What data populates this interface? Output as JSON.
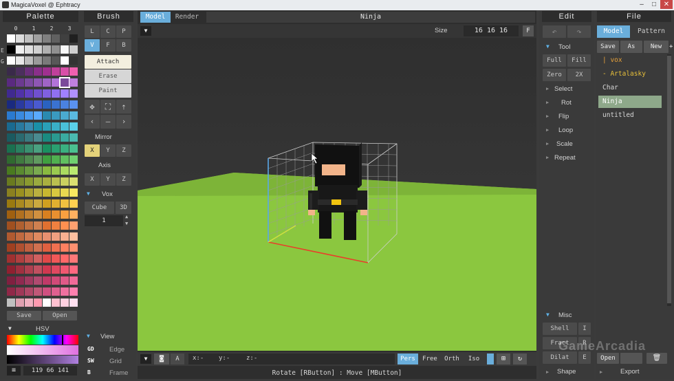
{
  "window": {
    "title": "MagicaVoxel @ Ephtracy",
    "controls": [
      "–",
      "□",
      "✕"
    ]
  },
  "palette": {
    "header": "Palette",
    "tabs": [
      "0",
      "1",
      "2",
      "3"
    ],
    "side_markers": [
      "E",
      "G"
    ],
    "save_label": "Save",
    "open_label": "Open",
    "hsv_label": "HSV",
    "color_values": "119 66 141",
    "selected_color": "#7b4a9a",
    "colors": [
      [
        "#ffffff",
        "#dcdcdc",
        "#c0c0c0",
        "#a0a0a0",
        "#808080",
        "#606060",
        "#404040",
        "#202020"
      ],
      [
        "#000000",
        "#f0f0f0",
        "#e0e0e0",
        "#d0d0d0",
        "#b0b0b0",
        "#909090",
        "#f8f8f8",
        "#cfcfcf"
      ],
      [
        "#ffffff",
        "#e8e8e8",
        "#bdbdbd",
        "#9a9a9a",
        "#7a7a7a",
        "#585858",
        "#ffffff",
        "#333333"
      ],
      [
        "#3a2a4a",
        "#4c2f5e",
        "#6a2f7a",
        "#8a2f8a",
        "#a0308f",
        "#c0409a",
        "#d84fa8",
        "#f060b0"
      ],
      [
        "#5a2a80",
        "#6b3a90",
        "#7b4aa0",
        "#8e56b4",
        "#a064c6",
        "#b273d8",
        "#7b4a9a",
        "#c080e0"
      ],
      [
        "#402a90",
        "#5032a8",
        "#6040c0",
        "#7050d0",
        "#8060e0",
        "#9070f0",
        "#a080ff",
        "#b090ff"
      ],
      [
        "#1a2a80",
        "#2a3aa0",
        "#3a4ac0",
        "#4a5ad0",
        "#2a62c0",
        "#3a72d0",
        "#4a82e0",
        "#5a92f0"
      ],
      [
        "#2a7ad0",
        "#3a8ae0",
        "#4a9af0",
        "#5aaaff",
        "#2a8ab0",
        "#3a9ac0",
        "#4aaad0",
        "#5abae0"
      ],
      [
        "#1a6a90",
        "#2a7aa0",
        "#3a8ab0",
        "#1a90a8",
        "#2aa0b8",
        "#3ab0c8",
        "#4ac0d8",
        "#5ad0e8"
      ],
      [
        "#1a5a60",
        "#2a6a70",
        "#3a7a80",
        "#4a8a90",
        "#1a8a80",
        "#2a9a90",
        "#3aaaa0",
        "#4abab0"
      ],
      [
        "#1a7050",
        "#2a8060",
        "#3a9070",
        "#4aa080",
        "#1a9060",
        "#2aa070",
        "#3ab080",
        "#4ac090"
      ],
      [
        "#306a30",
        "#407a40",
        "#508a50",
        "#609a60",
        "#40a040",
        "#50b050",
        "#60c060",
        "#70d070"
      ],
      [
        "#4a7a20",
        "#5a8a30",
        "#6a9a40",
        "#7aaa50",
        "#8aba40",
        "#9aca50",
        "#aada60",
        "#baea70"
      ],
      [
        "#6a7a20",
        "#7a8a30",
        "#8a9a30",
        "#9aaa40",
        "#aab040",
        "#bac050",
        "#cad060",
        "#dae070"
      ],
      [
        "#8a8020",
        "#9a9020",
        "#aaa030",
        "#bab040",
        "#c8b830",
        "#d8c840",
        "#e8d850",
        "#f8e860"
      ],
      [
        "#9a7a10",
        "#aa8a20",
        "#ba9a30",
        "#caaa40",
        "#d0a020",
        "#e0b030",
        "#f0c040",
        "#ffd050"
      ],
      [
        "#a06010",
        "#b07020",
        "#c08030",
        "#d09040",
        "#d88020",
        "#e89030",
        "#f8a040",
        "#ffb060"
      ],
      [
        "#a05020",
        "#b06030",
        "#c07040",
        "#d08050",
        "#e07030",
        "#f08040",
        "#ff9050",
        "#ffa070"
      ],
      [
        "#b05a30",
        "#c06a40",
        "#d07a50",
        "#e08a60",
        "#e89070",
        "#f0a080",
        "#f8b090",
        "#ffc0a0"
      ],
      [
        "#a04020",
        "#b05030",
        "#c06040",
        "#d07050",
        "#e06040",
        "#f07050",
        "#ff8060",
        "#ff9070"
      ],
      [
        "#a03030",
        "#b04040",
        "#c05050",
        "#d06060",
        "#e04848",
        "#f05858",
        "#ff6868",
        "#ff7878"
      ],
      [
        "#902030",
        "#a03040",
        "#b04050",
        "#c05060",
        "#d03850",
        "#e04860",
        "#f05870",
        "#ff6880"
      ],
      [
        "#802040",
        "#902a50",
        "#a03a60",
        "#b04a70",
        "#c03a68",
        "#d04a78",
        "#e05a88",
        "#f06a98"
      ],
      [
        "#902848",
        "#a03858",
        "#b04868",
        "#c05878",
        "#d05080",
        "#e06090",
        "#f070a0",
        "#ff80b0"
      ],
      [
        "#c0c0c0",
        "#e0a0b0",
        "#f0b0c0",
        "#ff9ab0",
        "#ffffff",
        "#ffc0d0",
        "#ffd0e0",
        "#ffe0f0"
      ]
    ]
  },
  "brush": {
    "header": "Brush",
    "shape_row1": [
      "L",
      "C",
      "P"
    ],
    "shape_row2": [
      "V",
      "F",
      "B"
    ],
    "modes": [
      "Attach",
      "Erase",
      "Paint"
    ],
    "mirror_label": "Mirror",
    "mirror": [
      "X",
      "Y",
      "Z"
    ],
    "axis_label": "Axis",
    "axis": [
      "X",
      "Y",
      "Z"
    ],
    "vox_label": "Vox",
    "cube_label": "Cube",
    "three_d_label": "3D",
    "vox_value": "1",
    "view_label": "View",
    "view_rows": [
      {
        "key": "GD",
        "label": "Edge"
      },
      {
        "key": "SW",
        "label": "Grid"
      },
      {
        "key": "B",
        "label": "Frame"
      }
    ]
  },
  "viewport": {
    "tabs": [
      "Model",
      "Render"
    ],
    "model_name": "Ninja",
    "size_label": "Size",
    "size_value": "16 16 16",
    "fit_label": "F",
    "coords": {
      "x": "x:-",
      "y": "y:-",
      "z": "z:-"
    },
    "camera_btn": "A",
    "projections": [
      "Pers",
      "Free",
      "Orth",
      "Iso"
    ],
    "status": "Rotate [RButton] : Move [MButton]"
  },
  "edit": {
    "header": "Edit",
    "tool_label": "Tool",
    "tool_buttons": [
      [
        "Full",
        "Fill"
      ],
      [
        "Zero",
        "2X"
      ]
    ],
    "actions": [
      "Select",
      "Rot",
      "Flip",
      "Loop",
      "Scale",
      "Repeat"
    ],
    "misc_label": "Misc",
    "misc_rows": [
      [
        "Shell",
        "I"
      ],
      [
        "Fract",
        "R"
      ],
      [
        "Dilat",
        "E"
      ]
    ],
    "shape_label": "Shape"
  },
  "file": {
    "header": "File",
    "tabs": [
      "Model",
      "Pattern"
    ],
    "actions": [
      "Save",
      "As",
      "New",
      "+"
    ],
    "items": [
      {
        "text": "| vox",
        "color": "#e8a23a"
      },
      {
        "text": "- Artalasky",
        "color": "#e8c03a"
      },
      {
        "text": "Char",
        "color": "#d8d8d8"
      },
      {
        "text": "Ninja",
        "color": "#ffffff",
        "selected": true
      },
      {
        "text": "untitled",
        "color": "#d8d8d8"
      }
    ],
    "open_label": "Open",
    "export_label": "Export"
  },
  "watermark": "GameArcadia"
}
